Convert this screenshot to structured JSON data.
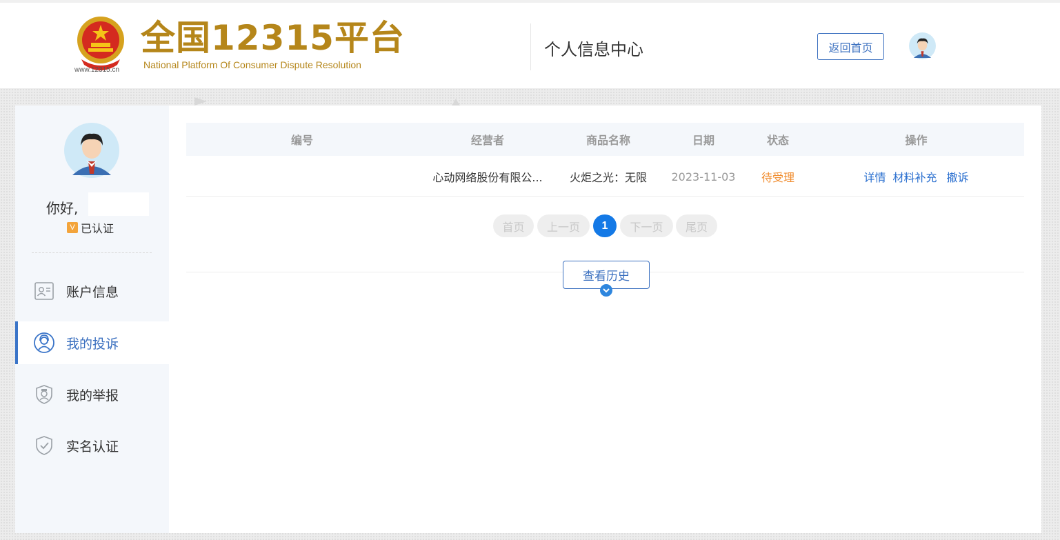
{
  "header": {
    "logo_url_text": "www.12315.cn",
    "logo_title": "全国12315平台",
    "logo_subtitle": "National Platform Of Consumer Dispute Resolution",
    "center_title": "个人信息中心",
    "home_button": "返回首页"
  },
  "sidebar": {
    "greeting": "你好,",
    "verified_badge": "V",
    "verified_label": "已认证",
    "items": [
      {
        "label": "账户信息",
        "icon": "id-card-icon",
        "active": false
      },
      {
        "label": "我的投诉",
        "icon": "user-headset-icon",
        "active": true
      },
      {
        "label": "我的举报",
        "icon": "police-shield-icon",
        "active": false
      },
      {
        "label": "实名认证",
        "icon": "shield-check-icon",
        "active": false
      }
    ]
  },
  "table": {
    "columns": [
      "编号",
      "经营者",
      "商品名称",
      "日期",
      "状态",
      "操作"
    ],
    "rows": [
      {
        "id": "",
        "operator": "心动网络股份有限公...",
        "product": "火炬之光：无限",
        "date": "2023-11-03",
        "status": "待受理",
        "actions": [
          "详情",
          "材料补充",
          "撤诉"
        ]
      }
    ]
  },
  "pagination": {
    "first": "首页",
    "prev": "上一页",
    "current": "1",
    "next": "下一页",
    "last": "尾页"
  },
  "history_button": "查看历史",
  "colors": {
    "brand_gold": "#b5861a",
    "primary_blue": "#3a6fbf",
    "link_blue": "#2a6fcf",
    "status_orange": "#f08c2e",
    "page_active": "#1479e6"
  }
}
